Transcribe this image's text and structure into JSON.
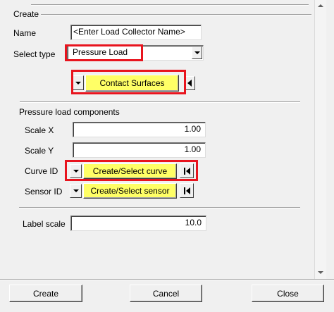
{
  "group_title": "Create",
  "name": {
    "label": "Name",
    "value": "<Enter Load Collector Name>"
  },
  "select_type": {
    "label": "Select type",
    "value": "Pressure Load"
  },
  "contact_surfaces": {
    "label": "Contact Surfaces"
  },
  "components": {
    "title": "Pressure load components",
    "scale_x": {
      "label": "Scale X",
      "value": "1.00"
    },
    "scale_y": {
      "label": "Scale Y",
      "value": "1.00"
    },
    "curve_id": {
      "label": "Curve ID",
      "button": "Create/Select curve"
    },
    "sensor_id": {
      "label": "Sensor ID",
      "button": "Create/Select sensor"
    }
  },
  "label_scale": {
    "label": "Label scale",
    "value": "10.0"
  },
  "footer": {
    "create": "Create",
    "cancel": "Cancel",
    "close": "Close"
  },
  "colors": {
    "highlight_button": "#ffff66",
    "annotation_box": "#e8141e",
    "background": "#f0f0f0"
  }
}
